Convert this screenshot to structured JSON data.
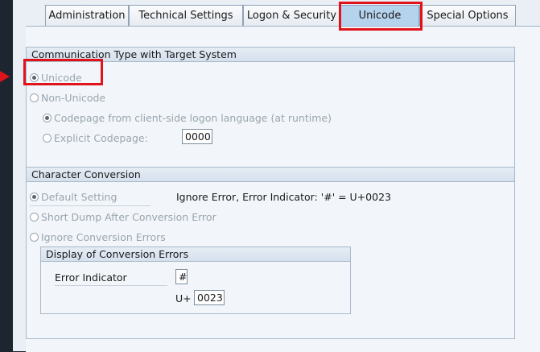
{
  "tabs": [
    {
      "label": "Administration"
    },
    {
      "label": "Technical Settings"
    },
    {
      "label": "Logon & Security"
    },
    {
      "label": "Unicode"
    },
    {
      "label": "Special Options"
    }
  ],
  "communication_group": {
    "title": "Communication Type with Target System",
    "unicode_label": "Unicode",
    "non_unicode_label": "Non-Unicode",
    "codepage_logon_label": "Codepage from client-side logon language (at runtime)",
    "explicit_codepage_label": "Explicit Codepage:",
    "explicit_codepage_value": "0000"
  },
  "character_conversion": {
    "title": "Character Conversion",
    "default_setting_label": "Default Setting",
    "default_setting_description": "Ignore Error, Error Indicator: '#' = U+0023",
    "short_dump_label": "Short Dump After Conversion Error",
    "ignore_errors_label": "Ignore Conversion Errors",
    "display_group": {
      "title": "Display of Conversion Errors",
      "error_indicator_label": "Error Indicator",
      "error_indicator_value": "#",
      "unicode_prefix": "U+",
      "unicode_value": "0023"
    }
  },
  "colors": {
    "highlight": "#e0131b",
    "active_tab": "#b6d3ee"
  }
}
